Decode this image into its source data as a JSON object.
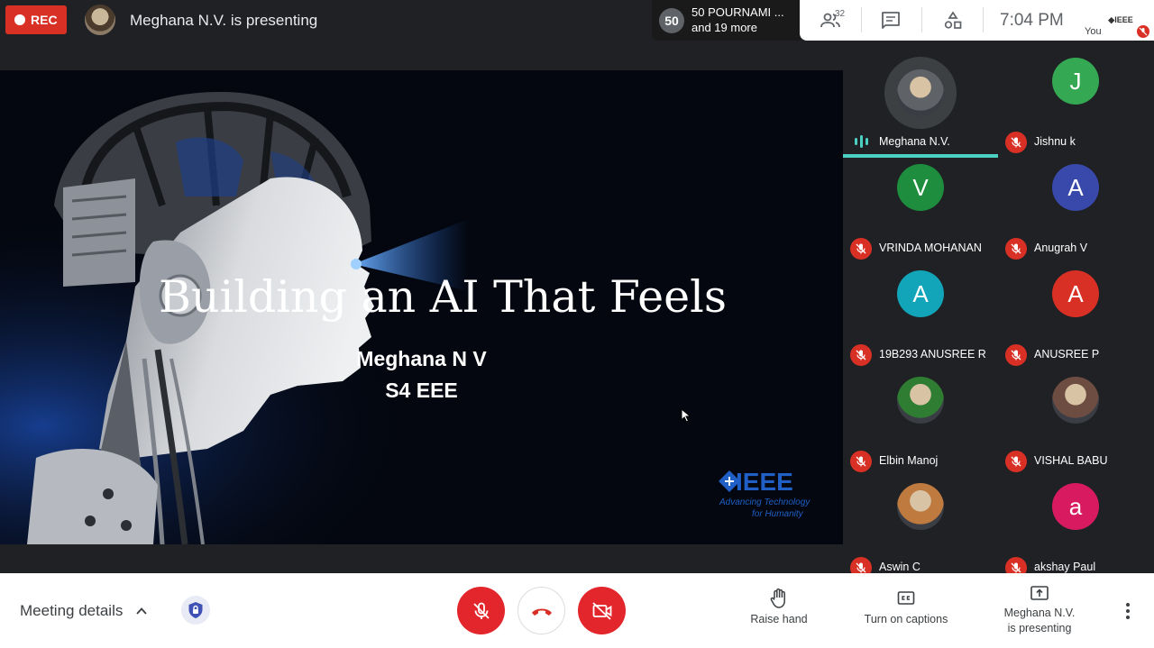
{
  "topbar": {
    "rec_label": "REC",
    "presenting_text": "Meghana N.V. is presenting",
    "others": {
      "count": "50",
      "line1": "50 POURNAMI ...",
      "line2": "and 19 more"
    },
    "participants_badge": "32",
    "time": "7:04 PM",
    "self_tile": {
      "logo_text": "◆IEEE",
      "label": "You"
    }
  },
  "slide": {
    "title": "Building an AI That Feels",
    "presenter_name": "Meghana N V",
    "class_name": "S4 EEE",
    "logo": {
      "word": "IEEE",
      "tagline_1": "Advancing Technology",
      "tagline_2": "for Humanity"
    }
  },
  "participants": [
    {
      "name": "Meghana N.V.",
      "initial": "",
      "color": "#5f6368",
      "speaking": true,
      "muted": false,
      "photo": true
    },
    {
      "name": "Jishnu k",
      "initial": "J",
      "color": "#34a853",
      "speaking": false,
      "muted": true,
      "photo": false
    },
    {
      "name": "VRINDA MOHANAN",
      "initial": "V",
      "color": "#1e8e3e",
      "speaking": false,
      "muted": true,
      "photo": false
    },
    {
      "name": "Anugrah V",
      "initial": "A",
      "color": "#3949ab",
      "speaking": false,
      "muted": true,
      "photo": false
    },
    {
      "name": "19B293 ANUSREE R",
      "initial": "A",
      "color": "#12a4b8",
      "speaking": false,
      "muted": true,
      "photo": false
    },
    {
      "name": "ANUSREE P",
      "initial": "A",
      "color": "#d93025",
      "speaking": false,
      "muted": true,
      "photo": false
    },
    {
      "name": "Elbin Manoj",
      "initial": "",
      "color": "#2e7d32",
      "speaking": false,
      "muted": true,
      "photo": true
    },
    {
      "name": "VISHAL BABU",
      "initial": "",
      "color": "#6d4c41",
      "speaking": false,
      "muted": true,
      "photo": true
    },
    {
      "name": "Aswin C",
      "initial": "",
      "color": "#bf7a40",
      "speaking": false,
      "muted": true,
      "photo": true
    },
    {
      "name": "akshay Paul",
      "initial": "a",
      "color": "#d81b60",
      "speaking": false,
      "muted": true,
      "photo": false
    }
  ],
  "bottombar": {
    "meeting_details": "Meeting details",
    "raise_hand": "Raise hand",
    "captions": "Turn on captions",
    "presenting_line1": "Meghana N.V.",
    "presenting_line2": "is presenting"
  },
  "colors": {
    "rec_red": "#d93025",
    "control_red": "#e3262b",
    "speaking_accent": "#4dd0c4",
    "ieee_blue": "#1f5fc6"
  }
}
